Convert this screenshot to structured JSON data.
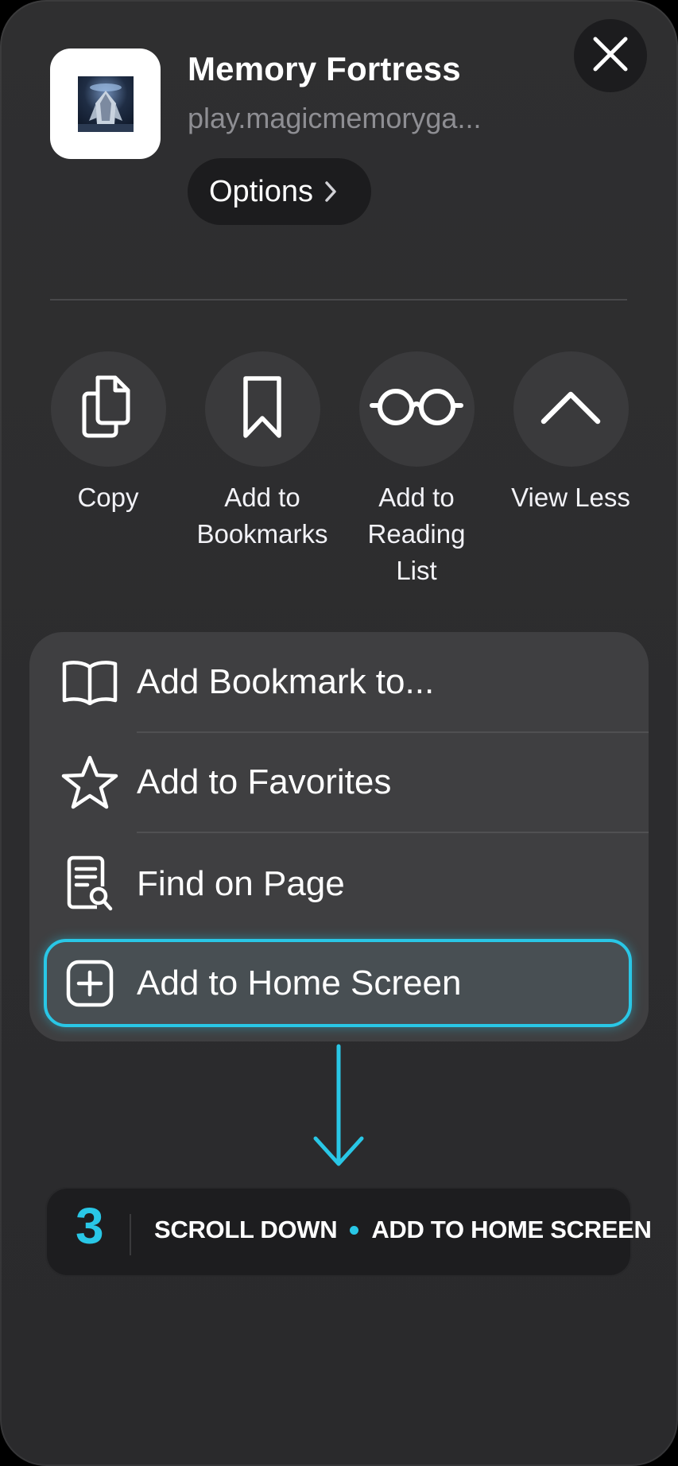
{
  "header": {
    "app_title": "Memory Fortress",
    "app_url": "play.magicmemoryga...",
    "options_label": "Options"
  },
  "actions": [
    {
      "label": "Copy",
      "icon": "copy-icon"
    },
    {
      "label": "Add to\nBookmarks",
      "icon": "bookmark-icon"
    },
    {
      "label": "Add to\nReading\nList",
      "icon": "reading-list-glasses-icon"
    },
    {
      "label": "View Less",
      "icon": "chevron-up-icon"
    }
  ],
  "menu": {
    "items": [
      {
        "label": "Add Bookmark to...",
        "icon": "open-book-icon"
      },
      {
        "label": "Add to Favorites",
        "icon": "star-icon"
      },
      {
        "label": "Find on Page",
        "icon": "find-on-page-icon"
      },
      {
        "label": "Add to Home Screen",
        "icon": "add-square-icon",
        "highlighted": true
      }
    ]
  },
  "step": {
    "number": "3",
    "text_part1": "SCROLL DOWN",
    "text_part2": "ADD TO HOME SCREEN"
  },
  "colors": {
    "accent": "#29c7e6",
    "sheet_background": "#2c2c2e",
    "card_background": "#3f3f41"
  }
}
